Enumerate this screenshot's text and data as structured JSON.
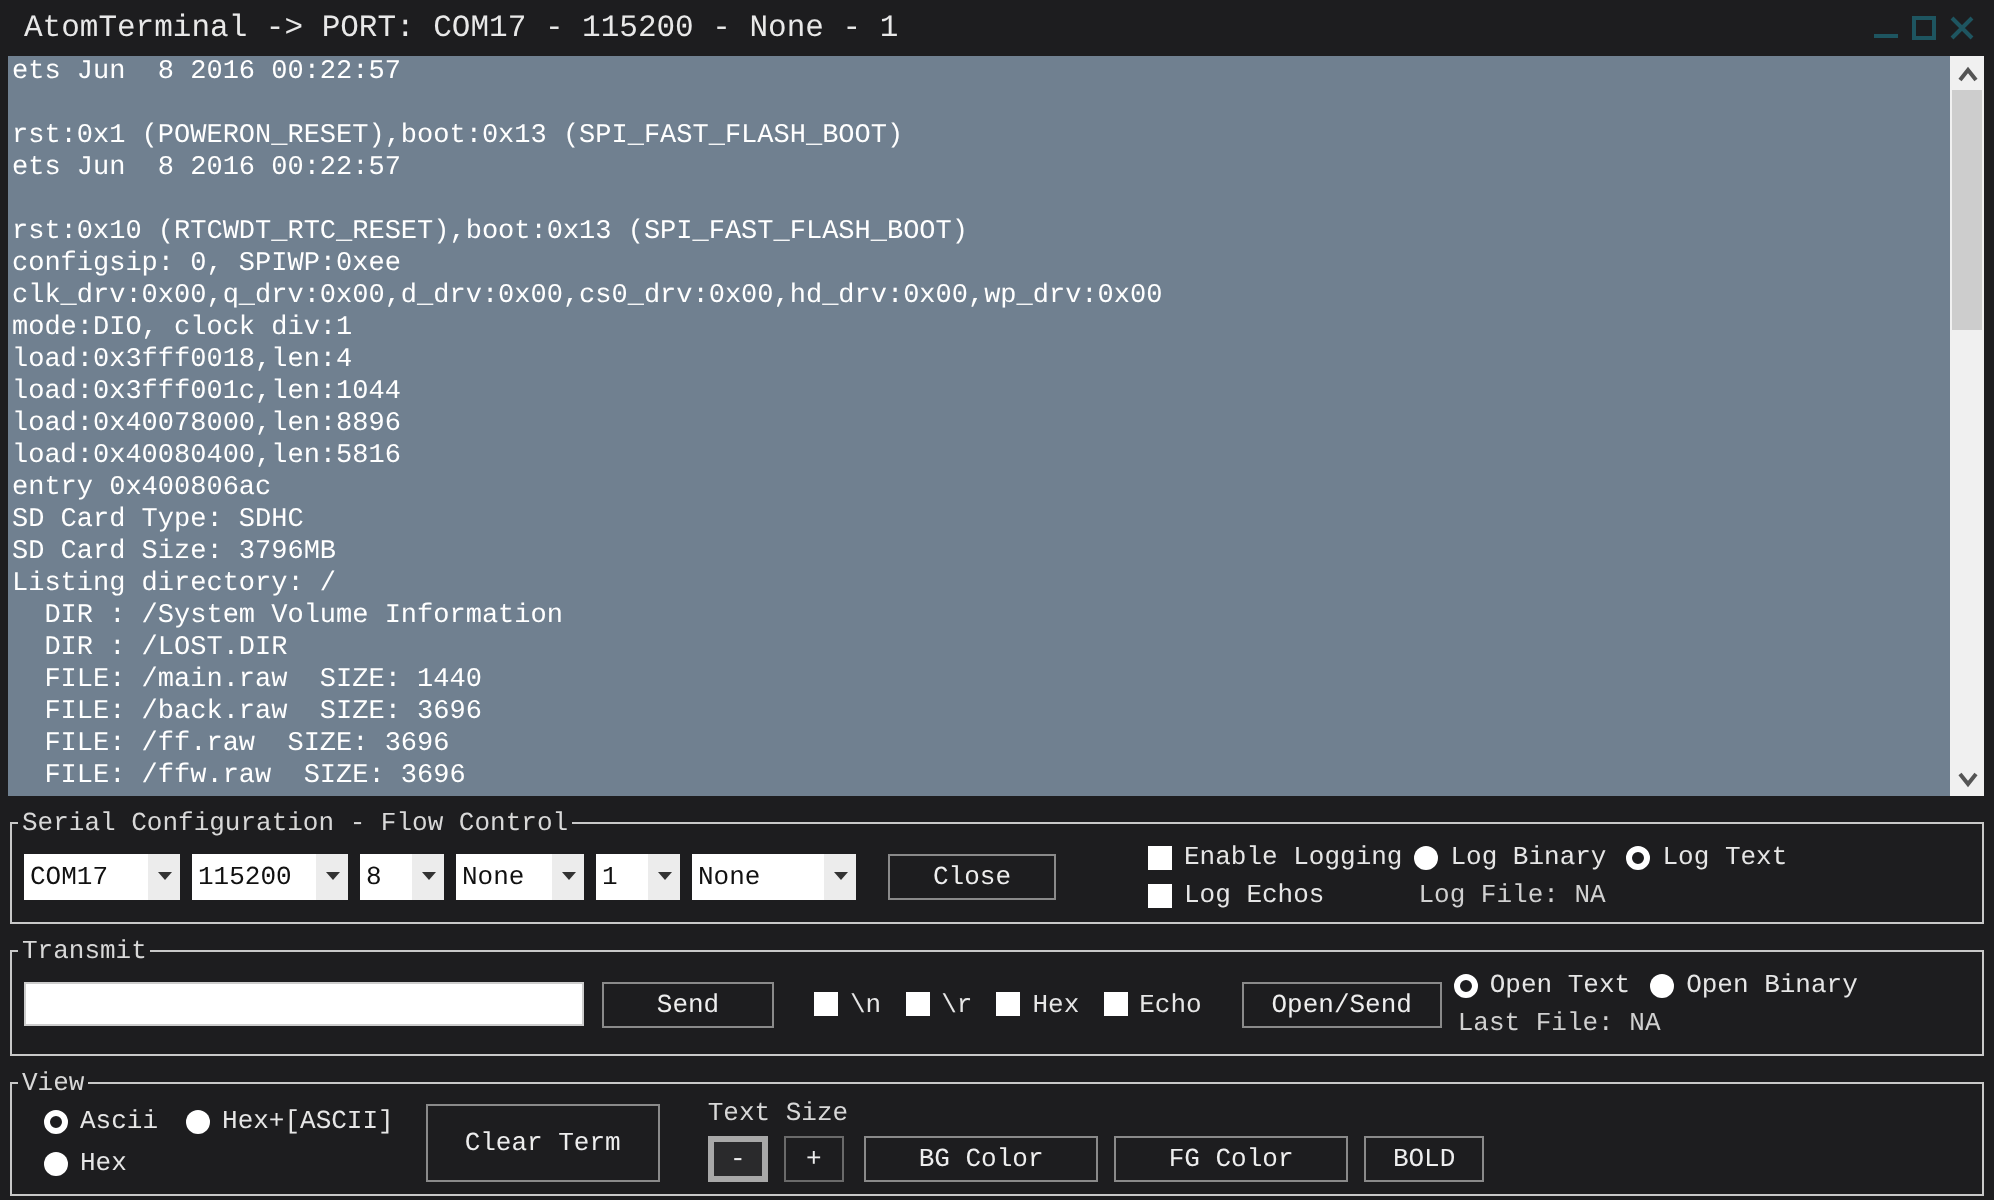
{
  "window": {
    "title": "AtomTerminal -> PORT: COM17 - 115200 - None - 1"
  },
  "terminal": {
    "blocks": [
      [
        "ets Jun  8 2016 00:22:57"
      ],
      [
        "rst:0x1 (POWERON_RESET),boot:0x13 (SPI_FAST_FLASH_BOOT)",
        "ets Jun  8 2016 00:22:57"
      ],
      [
        "rst:0x10 (RTCWDT_RTC_RESET),boot:0x13 (SPI_FAST_FLASH_BOOT)",
        "configsip: 0, SPIWP:0xee",
        "clk_drv:0x00,q_drv:0x00,d_drv:0x00,cs0_drv:0x00,hd_drv:0x00,wp_drv:0x00",
        "mode:DIO, clock div:1",
        "load:0x3fff0018,len:4",
        "load:0x3fff001c,len:1044",
        "load:0x40078000,len:8896",
        "load:0x40080400,len:5816",
        "entry 0x400806ac",
        "SD Card Type: SDHC",
        "SD Card Size: 3796MB",
        "Listing directory: /",
        "  DIR : /System Volume Information",
        "  DIR : /LOST.DIR",
        "  FILE: /main.raw  SIZE: 1440",
        "  FILE: /back.raw  SIZE: 3696",
        "  FILE: /ff.raw  SIZE: 3696",
        "  FILE: /ffw.raw  SIZE: 3696"
      ]
    ]
  },
  "serial": {
    "title": "Serial Configuration - Flow Control",
    "dropdowns": [
      {
        "value": "COM17"
      },
      {
        "value": "115200"
      },
      {
        "value": "8"
      },
      {
        "value": "None"
      },
      {
        "value": "1"
      },
      {
        "value": "None"
      }
    ],
    "button": "Close",
    "checkboxes": [
      {
        "label": "Enable Logging",
        "checked": false
      },
      {
        "label": "Log Echos",
        "checked": false
      }
    ],
    "radios": [
      {
        "label": "Log Binary",
        "selected": false
      },
      {
        "label": "Log Text",
        "selected": true
      }
    ],
    "log_file": "Log File: NA"
  },
  "transmit": {
    "title": "Transmit",
    "send": "Send",
    "checkboxes": [
      {
        "label": "\\n",
        "checked": false
      },
      {
        "label": "\\r",
        "checked": false
      },
      {
        "label": "Hex",
        "checked": false
      },
      {
        "label": "Echo",
        "checked": false
      }
    ],
    "open_send": "Open/Send",
    "radios": [
      {
        "label": "Open Text",
        "selected": true
      },
      {
        "label": "Open Binary",
        "selected": false
      }
    ],
    "last_file": "Last File: NA"
  },
  "view": {
    "title": "View",
    "radios": [
      {
        "label": "Ascii",
        "selected": true
      },
      {
        "label": "Hex+[ASCII]",
        "selected": false
      },
      {
        "label": "Hex",
        "selected": false
      }
    ],
    "clear": "Clear Term",
    "text_size": "Text Size",
    "size_buttons": [
      {
        "label": "-",
        "focused": true
      },
      {
        "label": "+",
        "focused": false
      }
    ],
    "buttons": [
      "BG Color",
      "FG Color",
      "BOLD"
    ]
  }
}
